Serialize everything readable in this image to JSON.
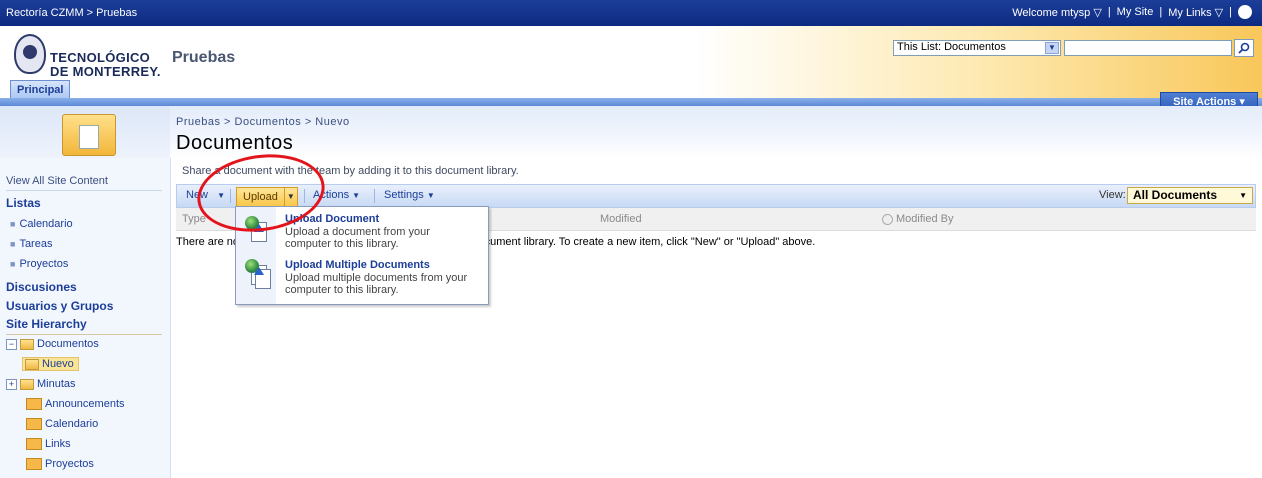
{
  "globalbar": {
    "breadcrumb": "Rectoría CZMM > Pruebas",
    "welcome": "Welcome mtysp ▽",
    "sep1": "|",
    "my_site": "My Site",
    "sep2": "|",
    "my_links": "My Links ▽",
    "sep3": "|"
  },
  "header": {
    "logo_line1": "TECNOLÓGICO",
    "logo_line2": "DE MONTERREY.",
    "site_title": "Pruebas",
    "search_scope": "This List: Documentos",
    "search_value": "",
    "tab_label": "Principal",
    "site_actions": "Site Actions ▾"
  },
  "page": {
    "breadcrumb": "Pruebas > Documentos > Nuevo",
    "title": "Documentos",
    "description": "Share a document with the team by adding it to this document library."
  },
  "leftnav": {
    "view_all": "View All Site Content",
    "listas": "Listas",
    "listas_items": [
      "Calendario",
      "Tareas",
      "Proyectos"
    ],
    "discusiones": "Discusiones",
    "usuarios": "Usuarios y Grupos",
    "hierarchy": "Site Hierarchy",
    "tree": {
      "documentos": "Documentos",
      "nuevo": "Nuevo",
      "minutas": "Minutas",
      "announcements": "Announcements",
      "calendario": "Calendario",
      "links": "Links",
      "proyectos": "Proyectos"
    }
  },
  "toolbar": {
    "new": "New",
    "upload": "Upload",
    "actions": "Actions",
    "settings": "Settings",
    "view_label": "View:",
    "view_value": "All Documents"
  },
  "columns": {
    "type": "Type",
    "modified": "Modified",
    "modified_by": "Modified By"
  },
  "empty_message": "There are no items to show in this view of the \"Documentos\" document library. To create a new item, click \"New\" or \"Upload\" above.",
  "upload_menu": [
    {
      "title": "Upload Document",
      "desc": "Upload a document from your computer to this library."
    },
    {
      "title": "Upload Multiple Documents",
      "desc": "Upload multiple documents from your computer to this library."
    }
  ],
  "colors": {
    "accent": "#1c3e98",
    "highlight": "#e3141b"
  }
}
